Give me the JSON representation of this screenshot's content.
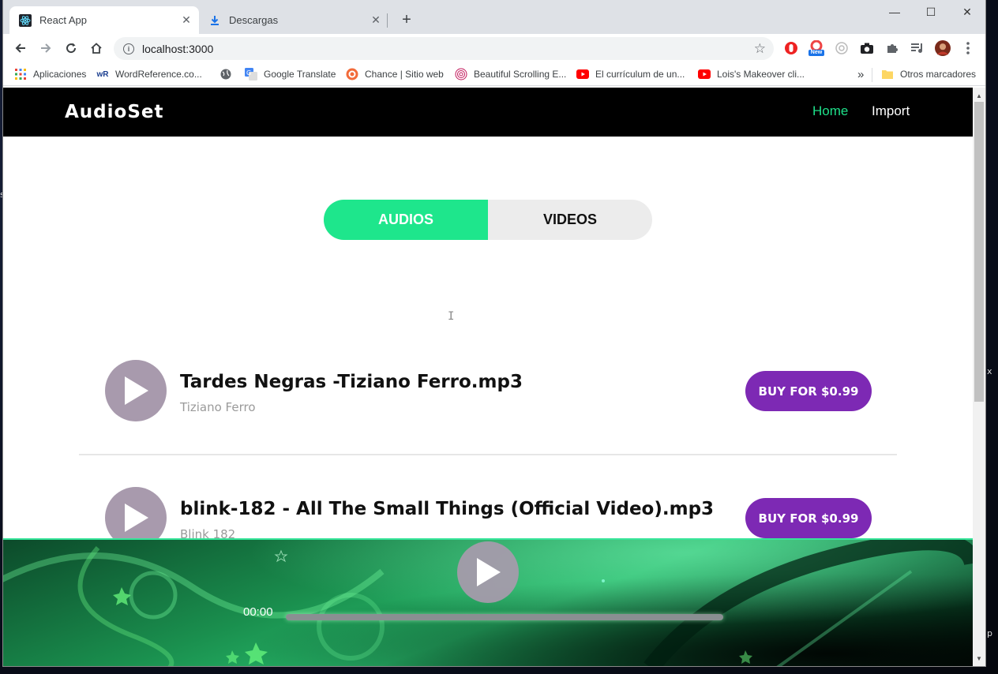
{
  "browser": {
    "tabs": [
      {
        "title": "React App",
        "active": true
      },
      {
        "title": "Descargas",
        "active": false
      }
    ],
    "window_controls": {
      "minimize": "—",
      "maximize": "☐",
      "close": "✕"
    },
    "address": "localhost:3000",
    "bookmarks": [
      {
        "label": "Aplicaciones",
        "icon": "apps-grid-icon"
      },
      {
        "label": "WordReference.co...",
        "icon": "wordreference-icon"
      },
      {
        "label": "",
        "icon": "globe-icon"
      },
      {
        "label": "Google Translate",
        "icon": "google-translate-icon"
      },
      {
        "label": "Chance | Sitio web",
        "icon": "chance-icon"
      },
      {
        "label": "Beautiful Scrolling E...",
        "icon": "scrolling-icon"
      },
      {
        "label": "El currículum de un...",
        "icon": "youtube-icon"
      },
      {
        "label": "Lois's Makeover cli...",
        "icon": "youtube-icon"
      }
    ],
    "bookmarks_overflow": "»",
    "other_bookmarks": "Otros marcadores",
    "extension_badge": "New"
  },
  "app": {
    "brand": "AudioSet",
    "nav": {
      "home": "Home",
      "import": "Import"
    },
    "toggle": {
      "audios": "AUDIOS",
      "videos": "VIDEOS",
      "selected": "AUDIOS"
    },
    "tracks": [
      {
        "title": "Tardes Negras -Tiziano Ferro.mp3",
        "artist": "Tiziano Ferro",
        "buy": "BUY FOR $0.99"
      },
      {
        "title": "blink-182 - All The Small Things (Official Video).mp3",
        "artist": "Blink 182",
        "buy": "BUY FOR $0.99"
      }
    ],
    "player": {
      "time": "00:00",
      "progress": 0
    }
  },
  "colors": {
    "accent_green": "#1ee68c",
    "buy_purple": "#7d29b4",
    "play_gray": "#a89aad",
    "navbar": "#000000"
  }
}
